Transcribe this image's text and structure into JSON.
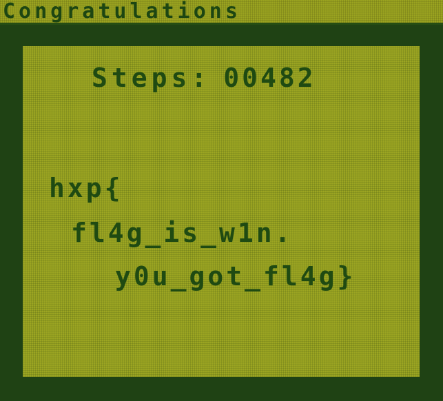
{
  "window": {
    "title": "Congratulations"
  },
  "screen": {
    "steps_label": "Steps:",
    "steps_value": "00482",
    "flag_lines": [
      "hxp{",
      "fl4g_is_w1n.",
      "y0u_got_fl4g}"
    ]
  },
  "colors": {
    "lcd_background": "#9ca522",
    "lcd_text": "#1f4a12",
    "frame": "#1f4214"
  }
}
